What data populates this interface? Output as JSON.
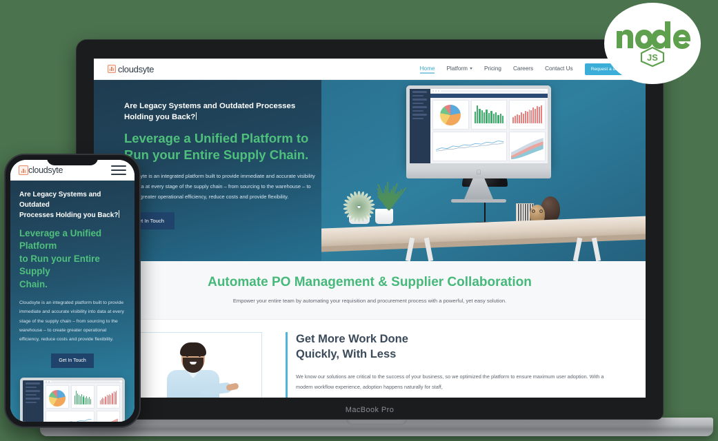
{
  "badge": {
    "name": "nodejs-logo",
    "word": "node",
    "sub": "JS",
    "color": "#5fa04e"
  },
  "device": {
    "laptop_label": "MacBook Pro",
    "apple_glyph": ""
  },
  "site": {
    "logo": {
      "text": "cloudsyte",
      "icon": "bar-chart-icon",
      "color": "#f08a65"
    },
    "nav": [
      {
        "label": "Home",
        "active": true,
        "has_chevron": false
      },
      {
        "label": "Platform",
        "active": false,
        "has_chevron": true
      },
      {
        "label": "Pricing",
        "active": false,
        "has_chevron": false
      },
      {
        "label": "Careers",
        "active": false,
        "has_chevron": false
      },
      {
        "label": "Contact Us",
        "active": false,
        "has_chevron": false
      }
    ],
    "cta_button": "Request a demo",
    "hero": {
      "kicker_line1": "Are Legacy Systems and Outdated Processes",
      "kicker_line2": "Holding you Back?",
      "title_line1": "Leverage a Unified Platform to",
      "title_line2": "Run your Entire Supply Chain.",
      "body": "Cloudsyte is an integrated platform built to provide immediate and accurate visibility into data at every stage of the supply chain – from sourcing to the warehouse – to create greater operational efficiency, reduce costs and provide flexibility.",
      "button": "Get In Touch",
      "accent_green": "#4fc07c",
      "bg_from": "#1f3c50",
      "bg_to": "#2a86a7"
    },
    "section_automate": {
      "heading": "Automate PO Management & Supplier Collaboration",
      "subheading": "Empower your entire team by automating your requisition and procurement process with a powerful, yet easy solution.",
      "heading_color": "#45b87a"
    },
    "section_work": {
      "heading_line1": "Get More Work Done",
      "heading_line2": "Quickly, With Less",
      "body": "We know our solutions are critical to the success of your business, so we optimized the platform to ensure maximum user adoption. With a modern workflow experience, adoption happens naturally for staff,",
      "accent_bar_color": "#4fb3dc",
      "photo_alt": "smiling-man-presenting"
    }
  },
  "phone": {
    "logo_text": "cloudsyte",
    "menu_icon": "hamburger-menu-icon",
    "kicker_line1": "Are Legacy Systems and Outdated",
    "kicker_line2": "Processes Holding you Back?",
    "title_line1": "Leverage a Unified Platform",
    "title_line2": "to Run your Entire Supply",
    "title_line3": "Chain.",
    "body": "Cloudsyte is an integrated platform built to provide immediate and accurate visibility into data at every stage of the supply chain – from sourcing to the warehouse – to create greater operational efficiency, reduce costs and provide flexibility.",
    "button": "Get In Touch"
  },
  "dashboard": {
    "bars_green": [
      60,
      92,
      74,
      66,
      58,
      70,
      52,
      62,
      48,
      56,
      44,
      50,
      38
    ],
    "bars_red": [
      30,
      38,
      46,
      42,
      54,
      50,
      62,
      58,
      70,
      66,
      78,
      74,
      86,
      82,
      90
    ],
    "pie_slices": [
      22,
      36,
      20,
      12,
      10
    ],
    "pie_colors": [
      "#5aa9dd",
      "#f2a65a",
      "#f4d06f",
      "#6fc48a",
      "#e87f7f"
    ]
  },
  "theme": {
    "page_bg": "#4b734e",
    "nav_active": "#3aa8cf",
    "demo_btn": "#3aaed8",
    "dark_btn": "#20436b"
  }
}
